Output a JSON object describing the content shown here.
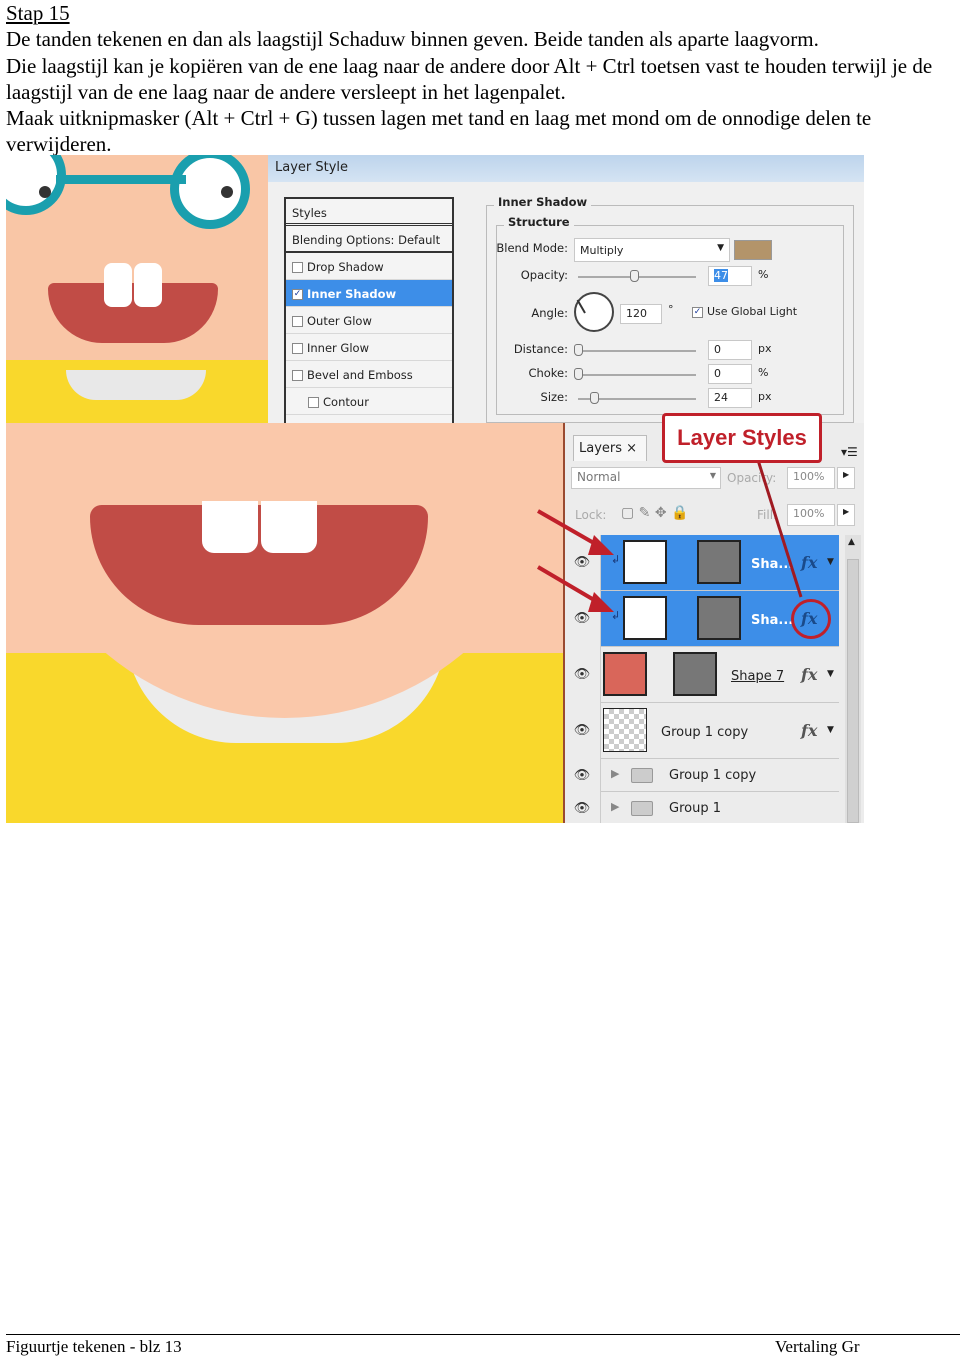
{
  "document": {
    "heading": "Stap 15",
    "paragraphs": [
      "De tanden tekenen en dan als laagstijl Schaduw binnen geven. Beide tanden als aparte laagvorm.",
      "Die laagstijl kan je kopiëren van de ene laag naar de andere door Alt + Ctrl toetsen vast te houden terwijl je de laagstijl van de ene laag naar de andere versleept in het lagenpalet.",
      "Maak uitknipmasker (Alt + Ctrl + G) tussen lagen met tand en laag met mond om de onnodige delen te verwijderen."
    ]
  },
  "layer_style_dialog": {
    "title": "Layer Style",
    "styles_header": "Styles",
    "blending_options": "Blending Options: Default",
    "items": [
      {
        "label": "Drop Shadow",
        "checked": false,
        "selected": false
      },
      {
        "label": "Inner Shadow",
        "checked": true,
        "selected": true
      },
      {
        "label": "Outer Glow",
        "checked": false,
        "selected": false
      },
      {
        "label": "Inner Glow",
        "checked": false,
        "selected": false
      },
      {
        "label": "Bevel and Emboss",
        "checked": false,
        "selected": false
      },
      {
        "label": "Contour",
        "checked": false,
        "selected": false
      }
    ],
    "section_title": "Inner Shadow",
    "subsection_title": "Structure",
    "blend_mode_label": "Blend Mode:",
    "blend_mode_value": "Multiply",
    "shadow_color": "#b3946a",
    "opacity_label": "Opacity:",
    "opacity_value": "47",
    "opacity_unit": "%",
    "angle_label": "Angle:",
    "angle_value": "120",
    "angle_unit": "°",
    "use_global_light_label": "Use Global Light",
    "use_global_light": true,
    "distance_label": "Distance:",
    "distance_value": "0",
    "distance_unit": "px",
    "choke_label": "Choke:",
    "choke_value": "0",
    "choke_unit": "%",
    "size_label": "Size:",
    "size_value": "24",
    "size_unit": "px"
  },
  "callout": {
    "label": "Layer Styles",
    "color": "#c0202a"
  },
  "layers_panel": {
    "tab_label": "Layers",
    "blend_mode": "Normal",
    "opacity_label": "Opacity:",
    "opacity_value": "100%",
    "lock_label": "Lock:",
    "fill_label": "Fill:",
    "fill_value": "100%",
    "selection_color": "#3d8ee8",
    "layers": [
      {
        "name": "Sha...",
        "selected": true,
        "fx": true,
        "clipped": true
      },
      {
        "name": "Sha...",
        "selected": true,
        "fx": true,
        "clipped": true
      },
      {
        "name": "Shape 7",
        "selected": false,
        "fx": true
      },
      {
        "name": "Group 1 copy",
        "selected": false,
        "fx": true
      },
      {
        "name": "Group 1 copy",
        "selected": false,
        "folder": true
      },
      {
        "name": "Group 1",
        "selected": false,
        "folder": true
      }
    ]
  },
  "footer": {
    "left": "Figuurtje tekenen - blz 13",
    "right": "Vertaling Gr"
  }
}
